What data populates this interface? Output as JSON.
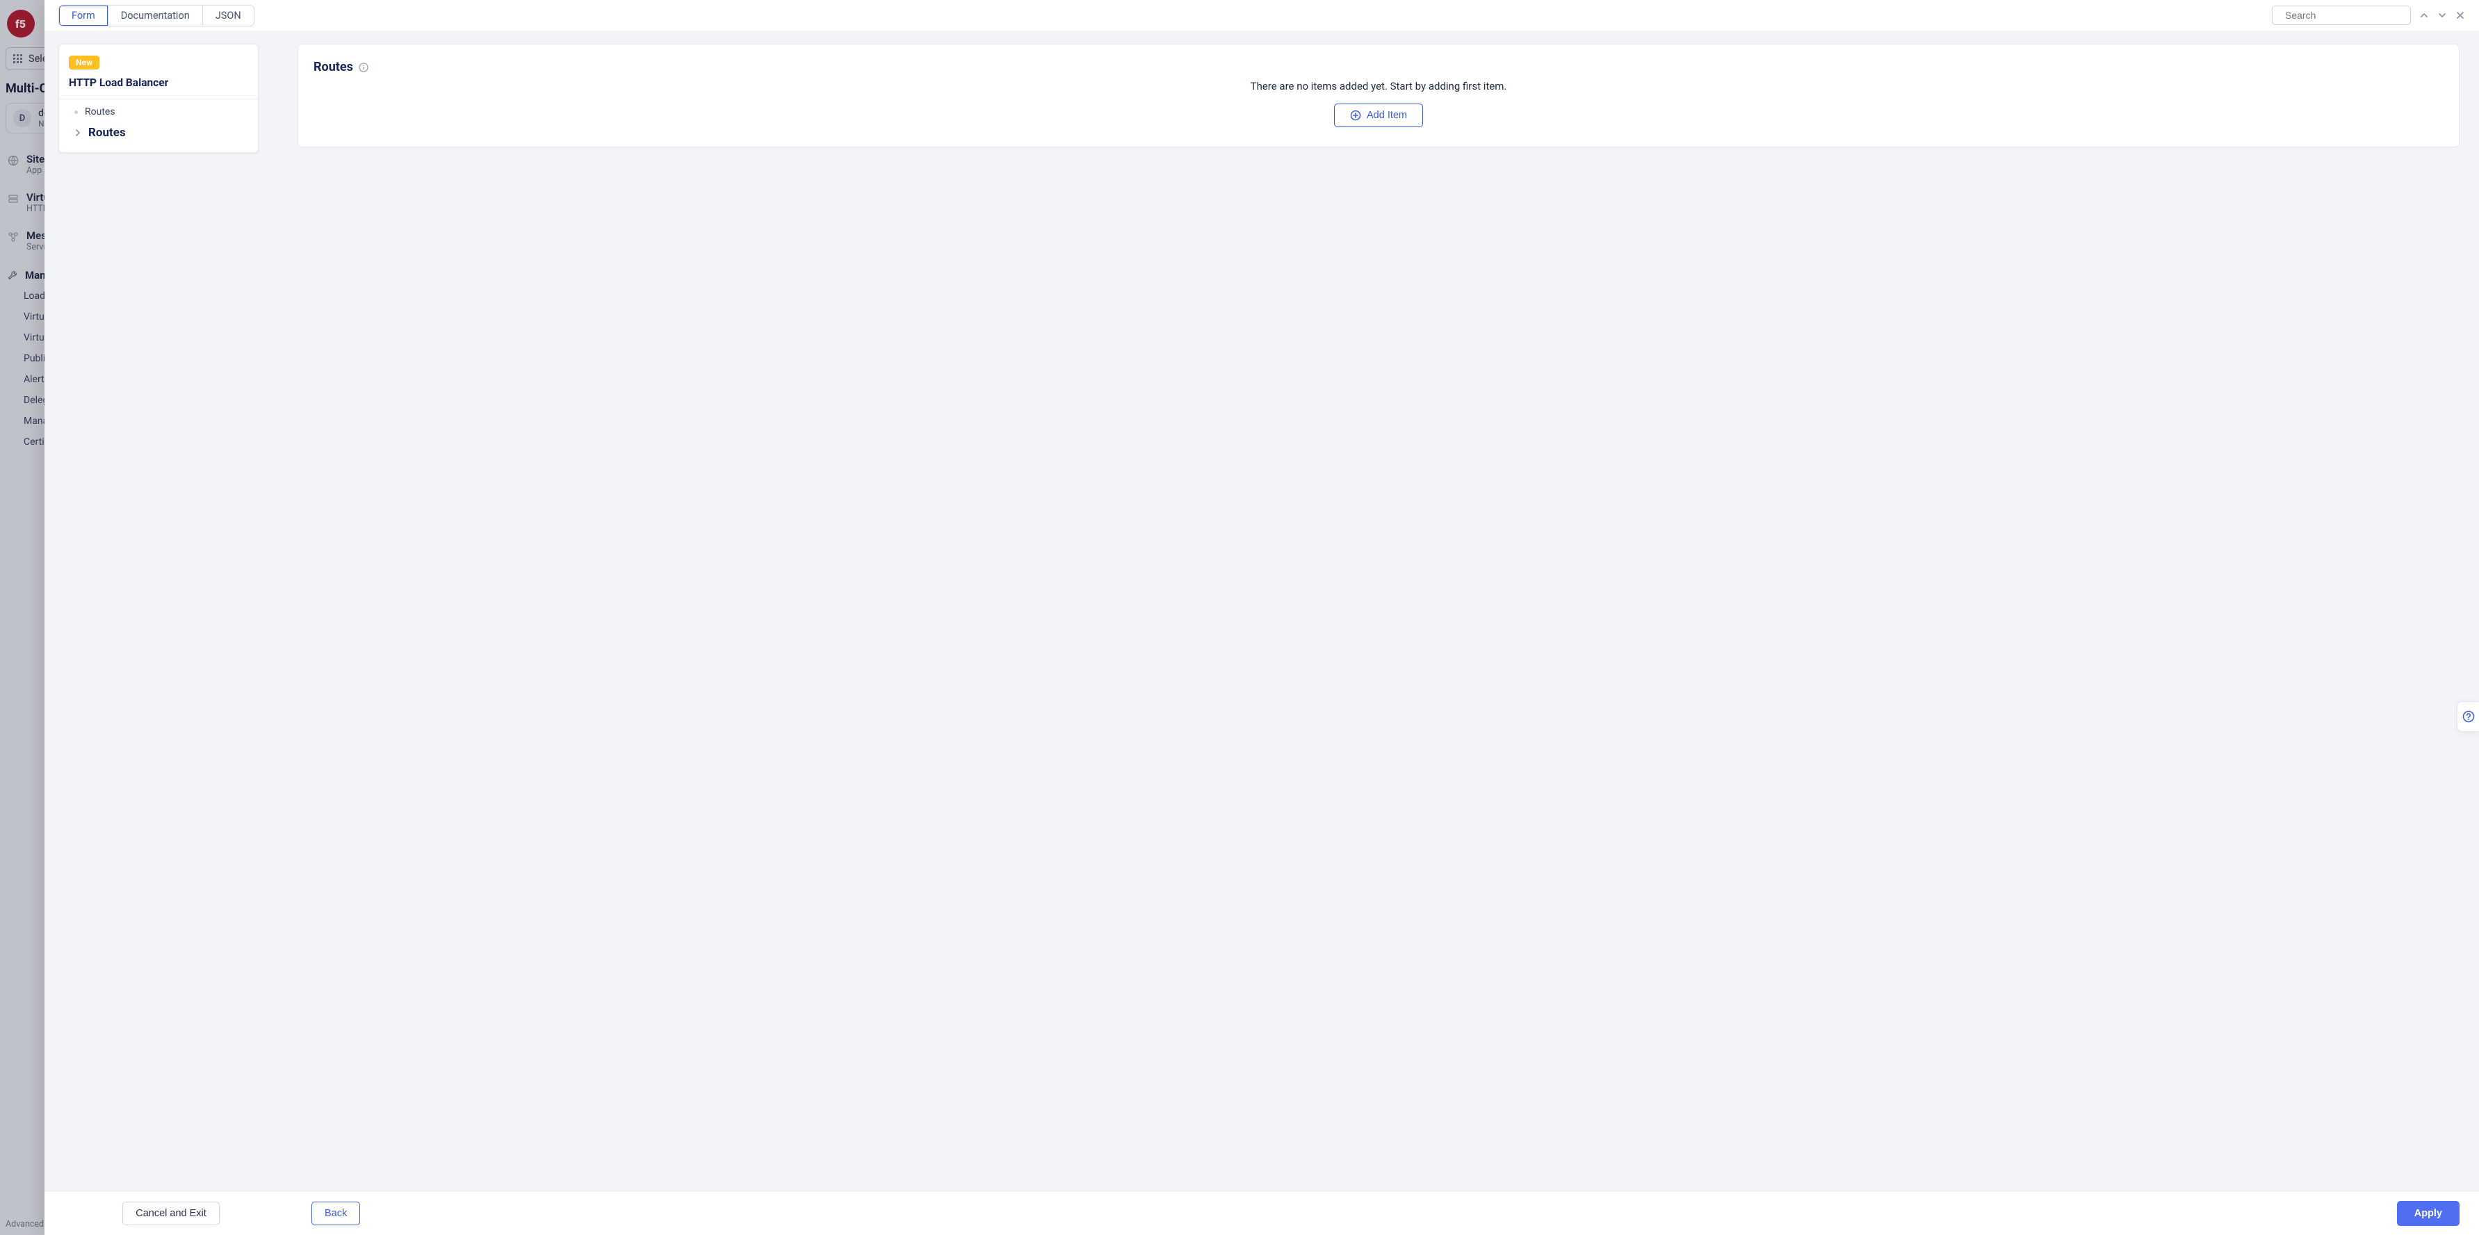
{
  "background": {
    "select_service_label": "Sele",
    "context_heading": "Multi-C",
    "workspace": {
      "letter": "D",
      "line1": "def",
      "line2": "Nam"
    },
    "sections": [
      {
        "title": "Site",
        "subtitle": "App S"
      },
      {
        "title": "Virtu",
        "subtitle": "HTTP"
      },
      {
        "title": "Mes",
        "subtitle": "Servi"
      }
    ],
    "manage_label": "Man",
    "manage_links": [
      "Load",
      "Virtu",
      "Virtu",
      "Publi",
      "Alert",
      "Deleg",
      "Mana",
      "Certi"
    ],
    "footer": "Advanced"
  },
  "topbar": {
    "tabs": {
      "form": "Form",
      "documentation": "Documentation",
      "json": "JSON"
    },
    "search_placeholder": "Search"
  },
  "tree": {
    "badge": "New",
    "title": "HTTP Load Balancer",
    "node_label": "Routes",
    "leaf_label": "Routes"
  },
  "panel": {
    "heading": "Routes",
    "empty_message": "There are no items added yet. Start by adding first item.",
    "add_item_label": "Add Item"
  },
  "footer": {
    "cancel_label": "Cancel and Exit",
    "back_label": "Back",
    "apply_label": "Apply"
  }
}
